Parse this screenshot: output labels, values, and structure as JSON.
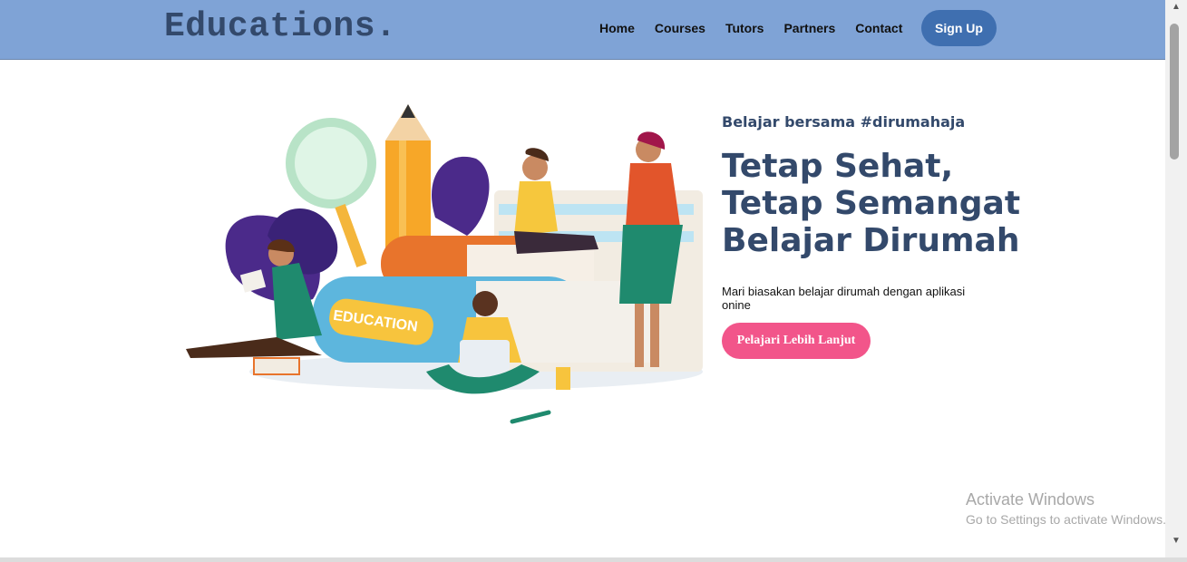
{
  "navbar": {
    "brand": "Educations.",
    "links": [
      "Home",
      "Courses",
      "Tutors",
      "Partners",
      "Contact"
    ],
    "signup_label": "Sign Up"
  },
  "hero": {
    "subtitle": "Belajar bersama #dirumahaja",
    "headline": [
      "Tetap Sehat,",
      "Tetap Semangat",
      "Belajar Dirumah"
    ],
    "description": "Mari biasakan belajar dirumah dengan aplikasi onine",
    "cta_label": "Pelajari Lebih Lanjut",
    "illustration_book_label": "EDUCATION"
  },
  "watermark": {
    "title": "Activate Windows",
    "subtitle": "Go to Settings to activate Windows."
  },
  "colors": {
    "navbar": "#7fa3d6",
    "brand_text": "#33496b",
    "signup_button": "#3f6fb0",
    "cta_button": "#f2558a"
  }
}
